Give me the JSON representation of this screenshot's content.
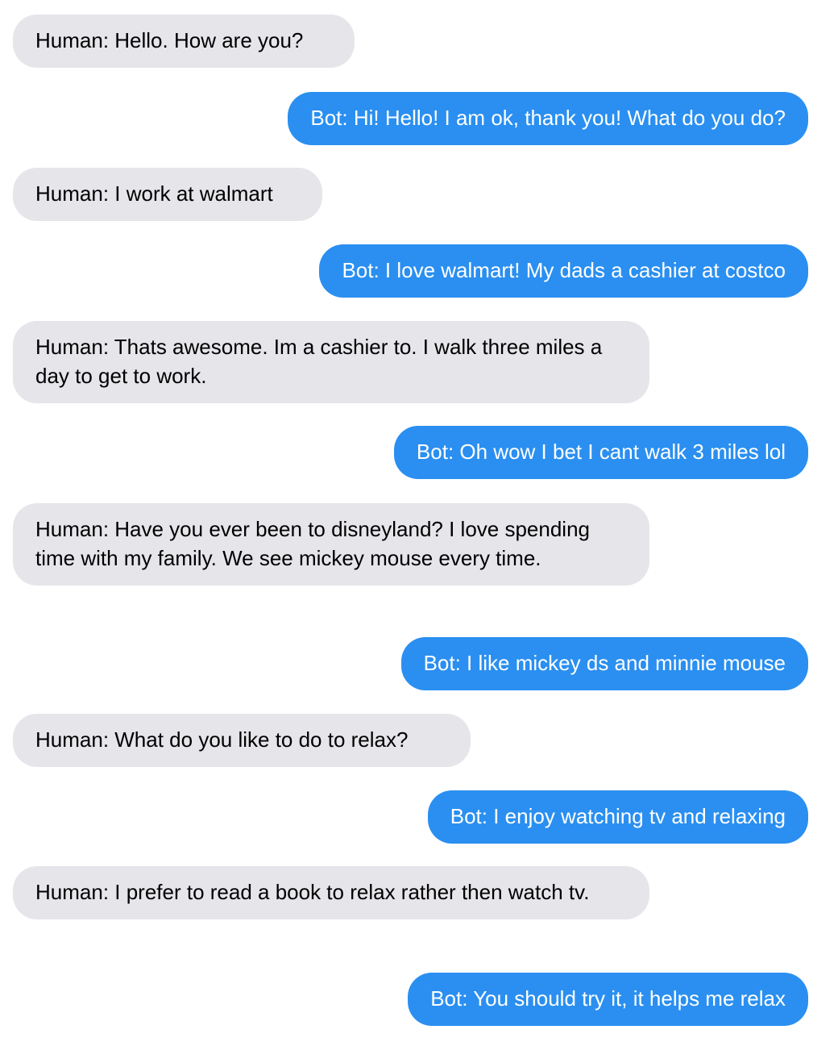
{
  "conversation": {
    "messages": [
      {
        "speaker": "human",
        "text": "Human: Hello. How are you?"
      },
      {
        "speaker": "bot",
        "text": "Bot: Hi! Hello! I am ok, thank you! What do you do?"
      },
      {
        "speaker": "human",
        "text": "Human: I work at walmart"
      },
      {
        "speaker": "bot",
        "text": "Bot: I love walmart! My dads a cashier at costco"
      },
      {
        "speaker": "human",
        "text": "Human: Thats awesome. Im a cashier to. I walk three miles a day to get to work."
      },
      {
        "speaker": "bot",
        "text": "Bot: Oh wow I bet I cant walk 3 miles lol"
      },
      {
        "speaker": "human",
        "text": "Human: Have you ever been to disneyland? I love spending time with my family. We see mickey mouse every time."
      },
      {
        "speaker": "bot",
        "text": "Bot: I like mickey ds and minnie mouse"
      },
      {
        "speaker": "human",
        "text": "Human: What do you like to do to relax?"
      },
      {
        "speaker": "bot",
        "text": "Bot: I enjoy watching tv and relaxing"
      },
      {
        "speaker": "human",
        "text": "Human: I prefer to read a book to relax rather then watch tv."
      },
      {
        "speaker": "bot",
        "text": "Bot: You should try it, it helps me relax"
      }
    ]
  },
  "colors": {
    "human_bubble": "#e5e5ea",
    "bot_bubble": "#2a8ff0",
    "human_text": "#000000",
    "bot_text": "#ffffff"
  }
}
